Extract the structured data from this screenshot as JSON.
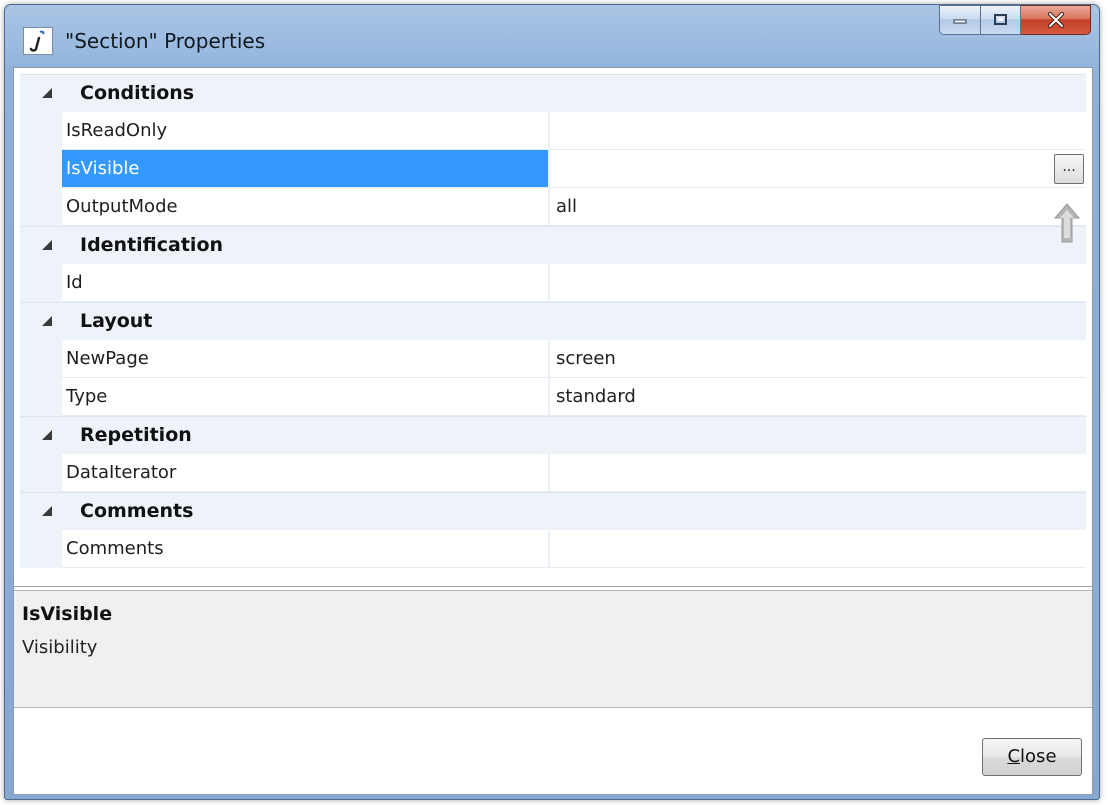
{
  "window": {
    "title": "\"Section\" Properties"
  },
  "icons": {
    "app": "script-j-icon",
    "minimize": "minimize-icon",
    "maximize": "maximize-icon",
    "close": "close-x-icon",
    "ellipsis": "ellipsis-icon",
    "cursor": "up-arrow-cursor-icon",
    "expander": "triangle-collapse-icon"
  },
  "categories": [
    {
      "label": "Conditions"
    },
    {
      "label": "Identification"
    },
    {
      "label": "Layout"
    },
    {
      "label": "Repetition"
    },
    {
      "label": "Comments"
    }
  ],
  "properties": {
    "isReadOnly": {
      "name": "IsReadOnly",
      "value": ""
    },
    "isVisible": {
      "name": "IsVisible",
      "value": "",
      "button": "..."
    },
    "outputMode": {
      "name": "OutputMode",
      "value": "all"
    },
    "id": {
      "name": "Id",
      "value": ""
    },
    "newPage": {
      "name": "NewPage",
      "value": "screen"
    },
    "type": {
      "name": "Type",
      "value": "standard"
    },
    "dataIterator": {
      "name": "DataIterator",
      "value": ""
    },
    "comments": {
      "name": "Comments",
      "value": ""
    }
  },
  "description": {
    "title": "IsVisible",
    "text": "Visibility"
  },
  "buttons": {
    "close_mnemonic": "C",
    "close_rest": "lose"
  },
  "colors": {
    "selection": "#3399ff",
    "category_bg": "#eef3f9",
    "titlebar": "#9bbbe0",
    "close_button": "#c4402a"
  }
}
